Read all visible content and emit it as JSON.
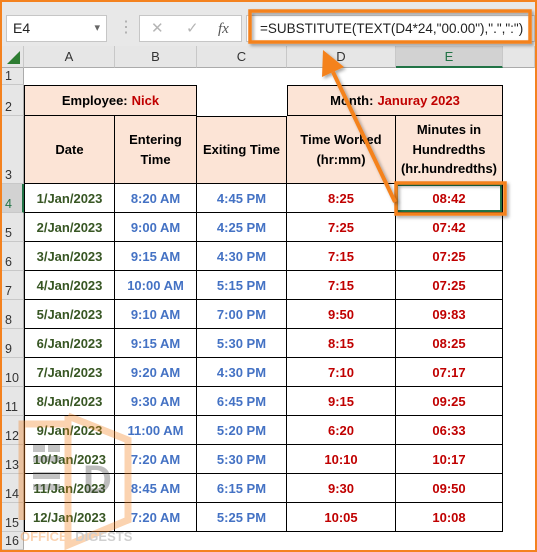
{
  "formula_bar": {
    "name_box": "E4",
    "name_box_dropdown_icon": "▾",
    "separator_icon": "⋮",
    "cancel_icon": "✕",
    "enter_icon": "✓",
    "insert_function_icon": "fx",
    "formula": "=SUBSTITUTE(TEXT(D4*24,\"00.00\"),\".\",\":\")"
  },
  "columns": [
    "A",
    "B",
    "C",
    "D",
    "E"
  ],
  "row_numbers": [
    "1",
    "2",
    "3",
    "4",
    "5",
    "6",
    "7",
    "8",
    "9",
    "10",
    "11",
    "12",
    "13",
    "14",
    "15",
    "16"
  ],
  "selected_cell": "E4",
  "sheet": {
    "employee_label": "Employee:",
    "employee_name": "Nick",
    "month_label": "Month:",
    "month_value": "Januray 2023",
    "headers": [
      "Date",
      "Entering\nTime",
      "Exiting Time",
      "Time Worked\n(hr:mm)",
      "Minutes in\nHundredths\n(hr.hundredths)"
    ],
    "rows": [
      {
        "date": "1/Jan/2023",
        "entering": "8:20 AM",
        "exiting": "4:45 PM",
        "worked": "8:25",
        "hundredths": "08:42"
      },
      {
        "date": "2/Jan/2023",
        "entering": "9:00 AM",
        "exiting": "4:25 PM",
        "worked": "7:25",
        "hundredths": "07:42"
      },
      {
        "date": "3/Jan/2023",
        "entering": "9:15 AM",
        "exiting": "4:30 PM",
        "worked": "7:15",
        "hundredths": "07:25"
      },
      {
        "date": "4/Jan/2023",
        "entering": "10:00 AM",
        "exiting": "5:15 PM",
        "worked": "7:15",
        "hundredths": "07:25"
      },
      {
        "date": "5/Jan/2023",
        "entering": "9:10 AM",
        "exiting": "7:00 PM",
        "worked": "9:50",
        "hundredths": "09:83"
      },
      {
        "date": "6/Jan/2023",
        "entering": "9:15 AM",
        "exiting": "5:30 PM",
        "worked": "8:15",
        "hundredths": "08:25"
      },
      {
        "date": "7/Jan/2023",
        "entering": "9:20 AM",
        "exiting": "4:30 PM",
        "worked": "7:10",
        "hundredths": "07:17"
      },
      {
        "date": "8/Jan/2023",
        "entering": "9:30 AM",
        "exiting": "6:45 PM",
        "worked": "9:15",
        "hundredths": "09:25"
      },
      {
        "date": "9/Jan/2023",
        "entering": "11:00 AM",
        "exiting": "5:20 PM",
        "worked": "6:20",
        "hundredths": "06:33"
      },
      {
        "date": "10/Jan/2023",
        "entering": "7:20 AM",
        "exiting": "5:30 PM",
        "worked": "10:10",
        "hundredths": "10:17"
      },
      {
        "date": "11/Jan/2023",
        "entering": "8:45 AM",
        "exiting": "6:15 PM",
        "worked": "9:30",
        "hundredths": "09:50"
      },
      {
        "date": "12/Jan/2023",
        "entering": "7:20 AM",
        "exiting": "5:25 PM",
        "worked": "10:05",
        "hundredths": "10:08"
      }
    ]
  },
  "watermark": {
    "word1": "OFFICE",
    "word2": "DIGESTS",
    "logo_letter": "D"
  },
  "colors": {
    "accent_orange": "#F4821F",
    "header_fill": "#FCE4D6",
    "date_text": "#375623",
    "time_text": "#4472C4",
    "value_text": "#C00000",
    "excel_green": "#217346"
  }
}
